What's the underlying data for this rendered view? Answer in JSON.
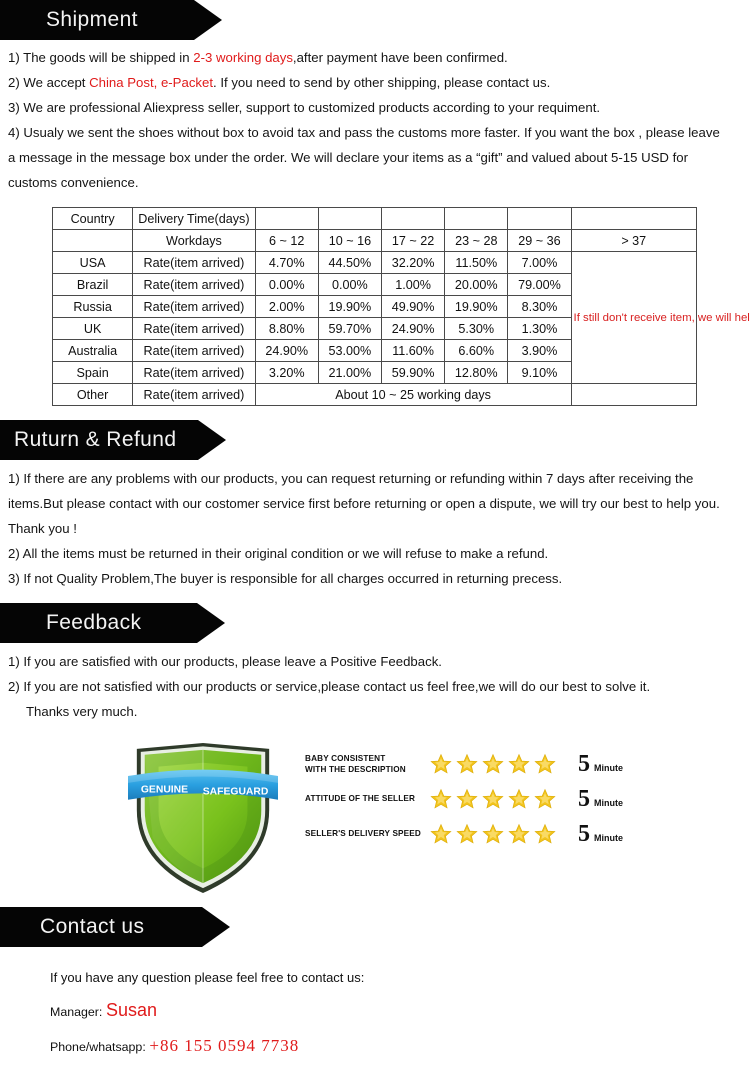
{
  "colors": {
    "accent_red": "#e01b1b",
    "banner_black": "#050505",
    "table_border": "#4a4a4a",
    "shield_green": "#76bc21",
    "ribbon_blue": "#2a9fe0",
    "star_gold": "#f5c518"
  },
  "sections": {
    "shipment": {
      "banner": "Shipment",
      "lines": [
        {
          "pre": "1) The goods will be shipped in ",
          "highlight": "2-3 working days",
          "post": ",after payment have been confirmed."
        },
        {
          "pre": "2) We accept ",
          "highlight": "China Post, e-Packet",
          "post": ". If you need to send by other shipping, please contact us."
        },
        {
          "pre": "3) We are professional Aliexpress seller, support to customized products according to your requiment.",
          "highlight": "",
          "post": ""
        },
        {
          "pre": "4) Usualy we sent the shoes without box to avoid tax and pass the customs more faster. If you want the box , please leave a message in the message box under the order. We will declare your items as a “gift” and valued about 5-15 USD for customs convenience.",
          "highlight": "",
          "post": ""
        }
      ]
    },
    "return_refund": {
      "banner": "Ruturn & Refund",
      "lines": [
        "1) If there are any problems with our products, you can request returning or refunding within 7 days after receiving the items.But please contact with our costomer service first before returning or open a dispute, we will try our best to help you. Thank you !",
        "2) All the items must be returned in their original condition or we will refuse to make a refund.",
        "3) If not Quality Problem,The buyer is responsible for all charges occurred in returning precess."
      ]
    },
    "feedback": {
      "banner": "Feedback",
      "lines": [
        "1) If you are satisfied with our products, please leave a Positive Feedback.",
        "2) If you are not satisfied with our products or service,please contact us feel free,we will do our best to solve it."
      ],
      "closing": "Thanks very much."
    },
    "contact": {
      "banner": "Contact us",
      "intro": "If you have any question please feel free to contact us:",
      "manager_label": "Manager:",
      "manager_name": "Susan",
      "phone_label": "Phone/whatsapp:",
      "phone_number": "+86  155  0594  7738"
    }
  },
  "delivery_table": {
    "header_row": [
      "Country",
      "Delivery Time(days)",
      "",
      "",
      "",
      "",
      "",
      ""
    ],
    "bins_label": "Workdays",
    "bins": [
      "6 ~ 12",
      "10 ~ 16",
      "17 ~ 22",
      "23 ~ 28",
      "29 ~ 36"
    ],
    "last_bin": "> 37",
    "rate_label": "Rate(item arrived)",
    "rows": [
      {
        "country": "USA",
        "rates": [
          "4.70%",
          "44.50%",
          "32.20%",
          "11.50%",
          "7.00%"
        ]
      },
      {
        "country": "Brazil",
        "rates": [
          "0.00%",
          "0.00%",
          "1.00%",
          "20.00%",
          "79.00%"
        ]
      },
      {
        "country": "Russia",
        "rates": [
          "2.00%",
          "19.90%",
          "49.90%",
          "19.90%",
          "8.30%"
        ]
      },
      {
        "country": "UK",
        "rates": [
          "8.80%",
          "59.70%",
          "24.90%",
          "5.30%",
          "1.30%"
        ]
      },
      {
        "country": "Australia",
        "rates": [
          "24.90%",
          "53.00%",
          "11.60%",
          "6.60%",
          "3.90%"
        ]
      },
      {
        "country": "Spain",
        "rates": [
          "3.20%",
          "21.00%",
          "59.90%",
          "12.80%",
          "9.10%"
        ]
      }
    ],
    "other_row": {
      "country": "Other",
      "label": "Rate(item arrived)",
      "text": "About 10 ~ 25 working days"
    },
    "note": "If still don't receive item, we will help to check. if confirm lost we will resend item."
  },
  "guarantee": {
    "shield_text_left": "GENUINE",
    "shield_text_right": "SAFEGUARD",
    "ratings": [
      {
        "label_line1": "BABY  CONSISTENT",
        "label_line2": "WITH THE DESCRIPTION",
        "stars": 5,
        "value": "5",
        "unit": "Minute"
      },
      {
        "label_line1": "ATTITUDE OF THE SELLER",
        "label_line2": "",
        "stars": 5,
        "value": "5",
        "unit": "Minute"
      },
      {
        "label_line1": "SELLER'S DELIVERY SPEED",
        "label_line2": "",
        "stars": 5,
        "value": "5",
        "unit": "Minute"
      }
    ]
  }
}
